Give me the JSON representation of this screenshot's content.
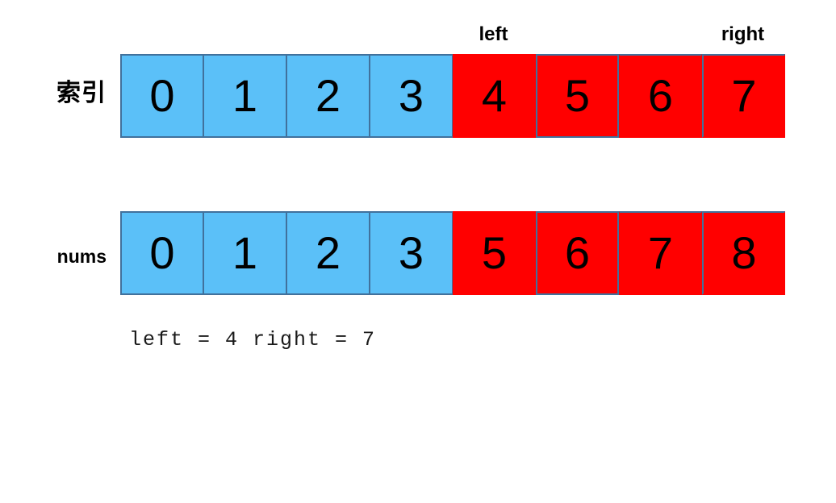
{
  "colors": {
    "cell_normal": "#5BC0F8",
    "cell_highlight": "#FF0000",
    "cell_border": "#41719C",
    "text": "#000000",
    "background": "#FFFFFF"
  },
  "pointers": [
    {
      "name": "left",
      "label": "left",
      "index": 4
    },
    {
      "name": "right",
      "label": "right",
      "index": 7
    }
  ],
  "rows": [
    {
      "name": "index-row",
      "label": "索引",
      "label_script": "cjk",
      "cells": [
        {
          "value": "0",
          "state": "normal"
        },
        {
          "value": "1",
          "state": "normal"
        },
        {
          "value": "2",
          "state": "normal"
        },
        {
          "value": "3",
          "state": "normal"
        },
        {
          "value": "4",
          "state": "highlight"
        },
        {
          "value": "5",
          "state": "highlight"
        },
        {
          "value": "6",
          "state": "highlight"
        },
        {
          "value": "7",
          "state": "highlight"
        }
      ]
    },
    {
      "name": "nums-row",
      "label": "nums",
      "label_script": "latin",
      "cells": [
        {
          "value": "0",
          "state": "normal"
        },
        {
          "value": "1",
          "state": "normal"
        },
        {
          "value": "2",
          "state": "normal"
        },
        {
          "value": "3",
          "state": "normal"
        },
        {
          "value": "5",
          "state": "highlight"
        },
        {
          "value": "6",
          "state": "highlight"
        },
        {
          "value": "7",
          "state": "highlight"
        },
        {
          "value": "8",
          "state": "highlight"
        }
      ]
    }
  ],
  "caption": {
    "text": "left = 4 right = 7"
  }
}
